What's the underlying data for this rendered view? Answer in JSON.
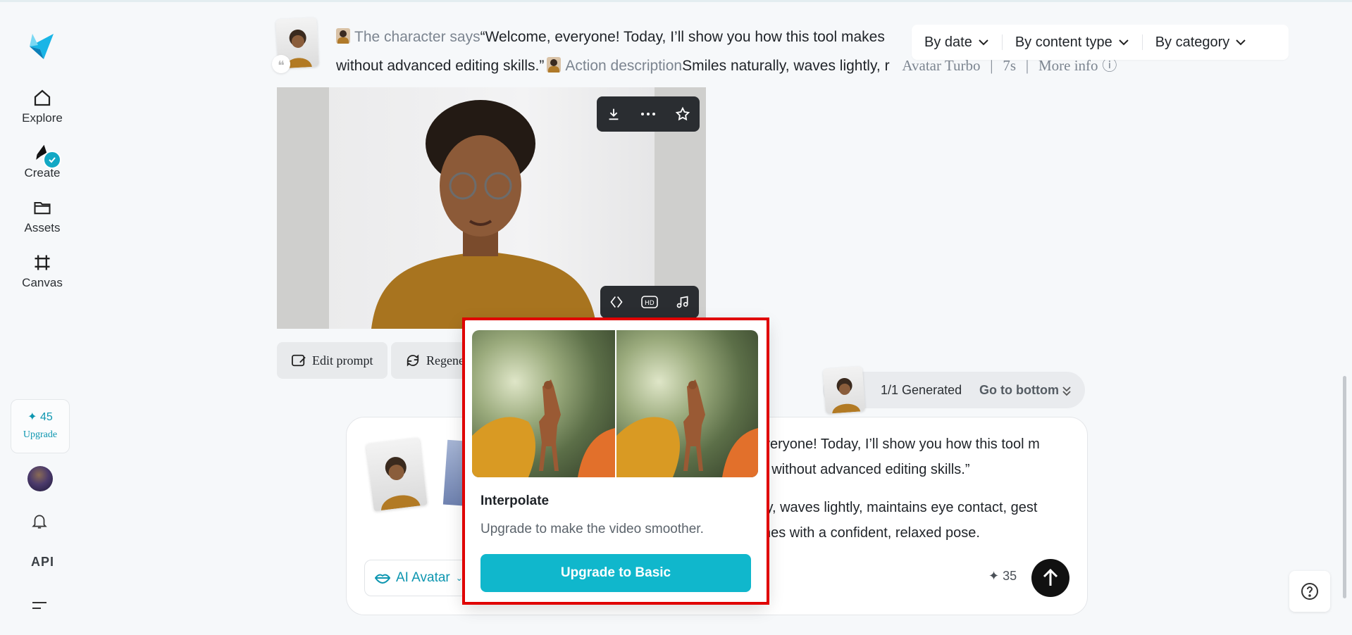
{
  "sidebar": {
    "items": [
      {
        "label": "Explore",
        "icon": "home-icon"
      },
      {
        "label": "Create",
        "icon": "create-icon"
      },
      {
        "label": "Assets",
        "icon": "folder-icon"
      },
      {
        "label": "Canvas",
        "icon": "canvas-icon"
      }
    ],
    "credits": "45",
    "upgrade_label": "Upgrade",
    "api_label": "API"
  },
  "prompt_line": {
    "says_label": "The character says",
    "quote_part1": "“Welcome, everyone! Today, I’ll show you how this tool makes",
    "quote_part2": "without advanced editing skills.”",
    "action_label": "Action description",
    "action_text": "Smiles naturally, waves lightly, r",
    "model": "Avatar Turbo",
    "duration": "7s",
    "more_info": "More info"
  },
  "filters": {
    "by_date": "By date",
    "by_content_type": "By content type",
    "by_category": "By category"
  },
  "actions": {
    "edit_prompt": "Edit prompt",
    "regenerate": "Regener"
  },
  "generated": {
    "count": "1/1",
    "label": "Generated",
    "go_to_bottom": "Go to bottom"
  },
  "composer": {
    "line1": "veryone! Today, I’ll show you how this tool m",
    "line2": "r without advanced editing skills.”",
    "line3": "ly, waves lightly, maintains eye contact, gest",
    "line4": "hes with a confident, relaxed pose.",
    "mode_label": "AI Avatar",
    "credits": "35"
  },
  "popup": {
    "title": "Interpolate",
    "description": "Upgrade to make the video smoother.",
    "button_label": "Upgrade to Basic"
  },
  "colors": {
    "accent": "#10b7cc",
    "highlight_box": "#e00000"
  }
}
